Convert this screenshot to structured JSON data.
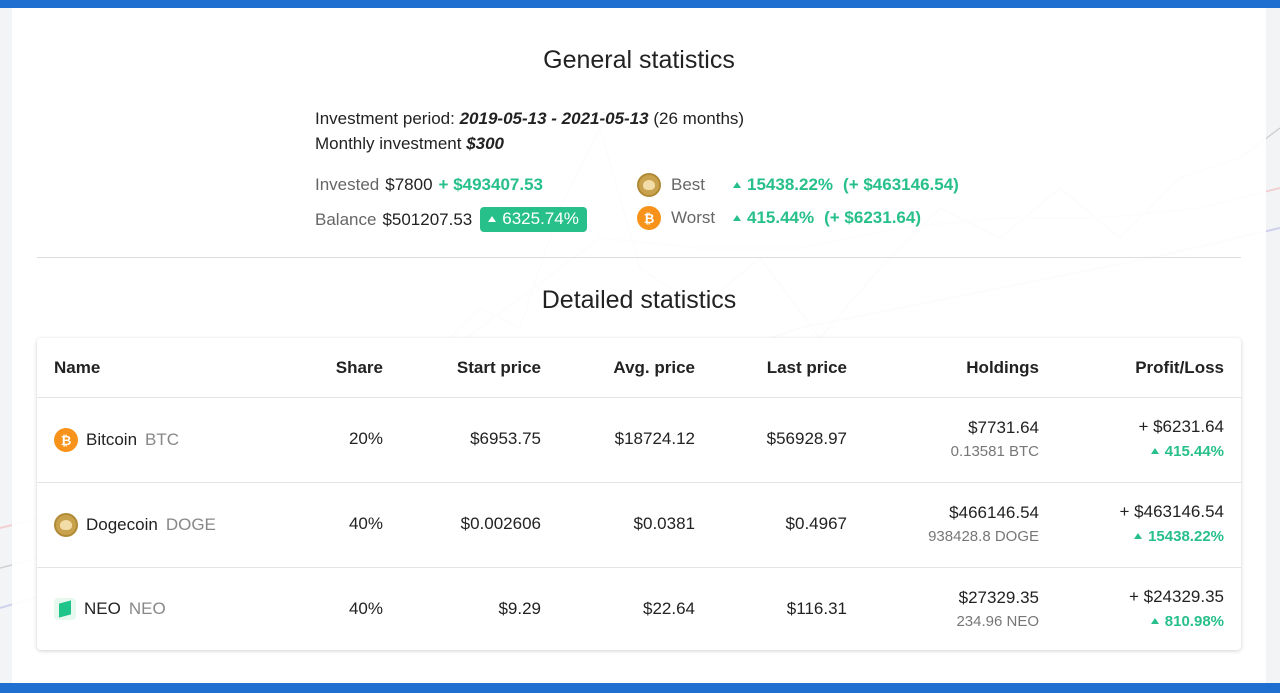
{
  "general": {
    "title": "General statistics",
    "period_label": "Investment period:",
    "period_value": "2019-05-13 - 2021-05-13",
    "period_months": "(26 months)",
    "monthly_label": "Monthly investment",
    "monthly_value": "$300",
    "invested_label": "Invested",
    "invested_value": "$7800",
    "invested_gain": "+ $493407.53",
    "balance_label": "Balance",
    "balance_value": "$501207.53",
    "balance_pct": "6325.74%",
    "best_label": "Best",
    "best_pct": "15438.22%",
    "best_abs": "(+ $463146.54)",
    "best_icon": "dogecoin-icon",
    "worst_label": "Worst",
    "worst_pct": "415.44%",
    "worst_abs": "(+ $6231.64)",
    "worst_icon": "bitcoin-icon"
  },
  "detailed": {
    "title": "Detailed statistics",
    "columns": [
      "Name",
      "Share",
      "Start price",
      "Avg. price",
      "Last price",
      "Holdings",
      "Profit/Loss"
    ],
    "rows": [
      {
        "name": "Bitcoin",
        "symbol": "BTC",
        "icon": "bitcoin-icon",
        "share": "20%",
        "start": "$6953.75",
        "avg": "$18724.12",
        "last": "$56928.97",
        "holdings": "$7731.64",
        "holdings_qty": "0.13581 BTC",
        "pl": "+ $6231.64",
        "pl_pct": "415.44%"
      },
      {
        "name": "Dogecoin",
        "symbol": "DOGE",
        "icon": "dogecoin-icon",
        "share": "40%",
        "start": "$0.002606",
        "avg": "$0.0381",
        "last": "$0.4967",
        "holdings": "$466146.54",
        "holdings_qty": "938428.8 DOGE",
        "pl": "+ $463146.54",
        "pl_pct": "15438.22%"
      },
      {
        "name": "NEO",
        "symbol": "NEO",
        "icon": "neo-icon",
        "share": "40%",
        "start": "$9.29",
        "avg": "$22.64",
        "last": "$116.31",
        "holdings": "$27329.35",
        "holdings_qty": "234.96 NEO",
        "pl": "+ $24329.35",
        "pl_pct": "810.98%"
      }
    ]
  },
  "colors": {
    "accent": "#1f6fd1",
    "positive": "#27c08a",
    "bitcoin": "#f7931a",
    "dogecoin": "#c8a24c",
    "neo": "#1ec48a"
  }
}
